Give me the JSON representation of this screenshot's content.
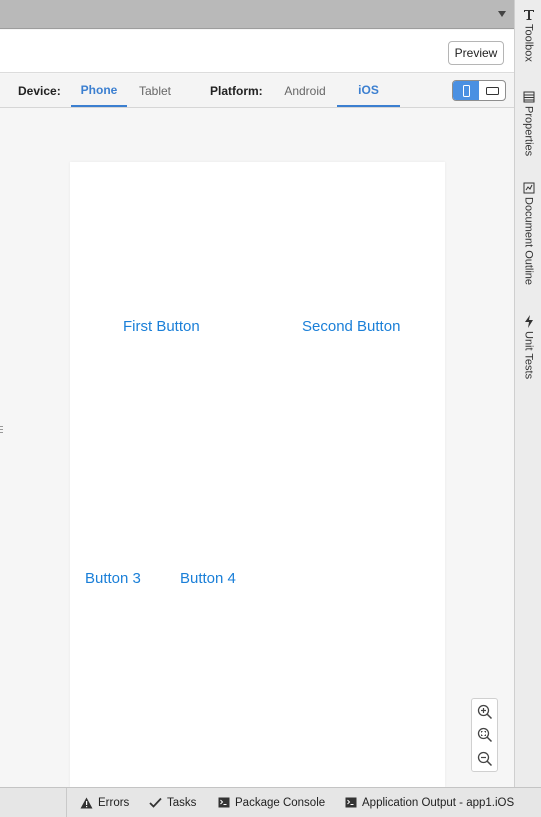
{
  "toolbar": {
    "preview_label": "Preview"
  },
  "device_bar": {
    "device_label": "Device:",
    "device_tabs": [
      {
        "label": "Phone",
        "active": true
      },
      {
        "label": "Tablet",
        "active": false
      }
    ],
    "platform_label": "Platform:",
    "platform_tabs": [
      {
        "label": "Android",
        "active": false
      },
      {
        "label": "iOS",
        "active": true
      }
    ],
    "orientation": {
      "selected": "portrait"
    }
  },
  "design_surface": {
    "buttons": [
      {
        "label": "First Button"
      },
      {
        "label": "Second Button"
      },
      {
        "label": "Button 3"
      },
      {
        "label": "Button 4"
      }
    ],
    "button_color": "#1a7fd8"
  },
  "zoom_controls": {
    "icons": [
      "zoom-in-icon",
      "zoom-fit-icon",
      "zoom-out-icon"
    ]
  },
  "sidebar": {
    "items": [
      {
        "label": "Toolbox",
        "icon": "toolbox-icon"
      },
      {
        "label": "Properties",
        "icon": "properties-icon"
      },
      {
        "label": "Document Outline",
        "icon": "document-outline-icon"
      },
      {
        "label": "Unit Tests",
        "icon": "unit-tests-icon"
      }
    ]
  },
  "status_bar": {
    "items": [
      {
        "label": "Errors",
        "icon": "warning-icon"
      },
      {
        "label": "Tasks",
        "icon": "checkmark-icon"
      },
      {
        "label": "Package Console",
        "icon": "terminal-icon"
      },
      {
        "label": "Application Output - app1.iOS",
        "icon": "terminal-icon"
      }
    ]
  },
  "colors": {
    "accent": "#3b7fd0",
    "toggle_active": "#4a90e2"
  }
}
